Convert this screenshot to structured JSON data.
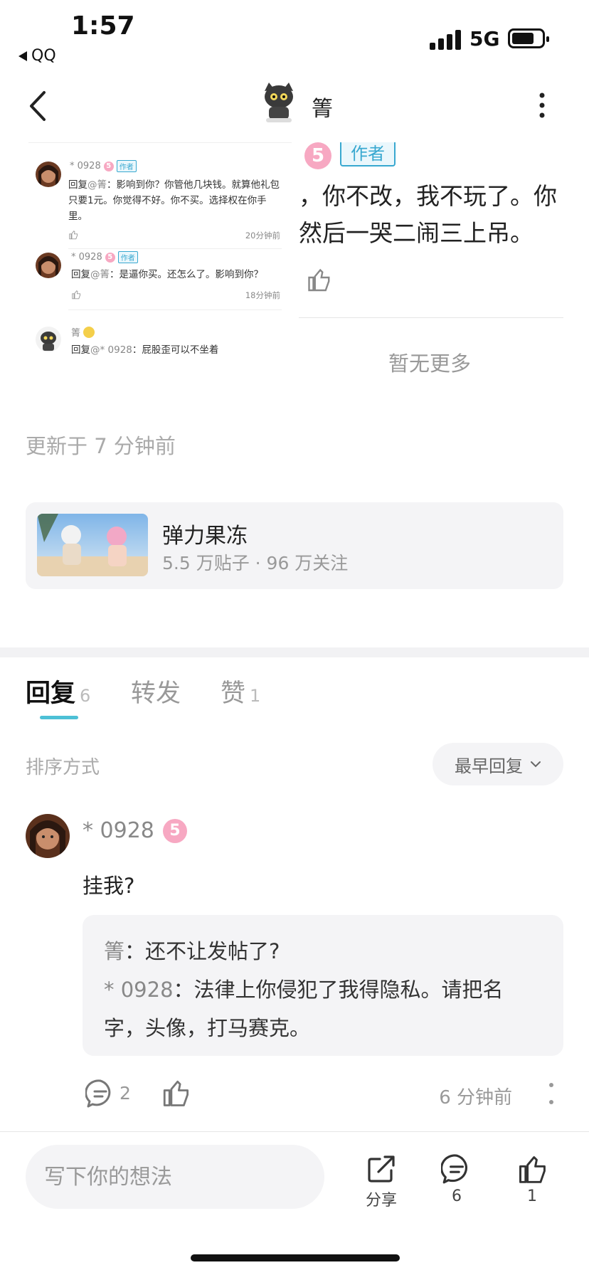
{
  "status_bar": {
    "time": "1:57",
    "back_app": "QQ",
    "network": "5G"
  },
  "nav": {
    "title": "箐"
  },
  "embedded_screenshot": {
    "comments": [
      {
        "name": "* 0928",
        "badge": "5",
        "author_tag": "作者",
        "reply_prefix": "回复",
        "reply_target": "@箐",
        "text": "：影响到你？你管他几块钱。就算他礼包只要1元。你觉得不好。你不买。选择权在你手里。",
        "time": "20分钟前"
      },
      {
        "name": "* 0928",
        "badge": "5",
        "author_tag": "作者",
        "reply_prefix": "回复",
        "reply_target": "@箐",
        "text": "：是逼你买。还怎么了。影响到你？",
        "time": "18分钟前"
      },
      {
        "name": "箐",
        "reply_prefix": "回复",
        "reply_target": "@* 0928",
        "text": "：屁股歪可以不坐着"
      }
    ],
    "right_panel": {
      "badge": "5",
      "author_tag": "作者",
      "line1": "，你不改，我不玩了。你",
      "line2": "然后一哭二闹三上吊。",
      "no_more": "暂无更多"
    }
  },
  "updated": "更新于 7 分钟前",
  "forum": {
    "name": "弹力果冻",
    "stats": "5.5 万贴子 · 96 万关注"
  },
  "tabs": [
    {
      "label": "回复",
      "count": "6"
    },
    {
      "label": "转发",
      "count": ""
    },
    {
      "label": "赞",
      "count": "1"
    }
  ],
  "sort": {
    "label": "排序方式",
    "value": "最早回复"
  },
  "reply": {
    "name": "* 0928",
    "badge": "5",
    "text": "挂我?",
    "subreplies": [
      {
        "name": "箐",
        "text": "：还不让发帖了?"
      },
      {
        "name": "* 0928",
        "text": "：法律上你侵犯了我得隐私。请把名字，头像，打马赛克。"
      }
    ],
    "comment_count": "2",
    "time": "6 分钟前"
  },
  "bottom_bar": {
    "placeholder": "写下你的想法",
    "share_label": "分享",
    "comment_count": "6",
    "like_count": "1"
  },
  "colors": {
    "accent": "#4dc0d6",
    "author_tag": "#38a8d0",
    "badge_pink": "#f7a8c2"
  }
}
